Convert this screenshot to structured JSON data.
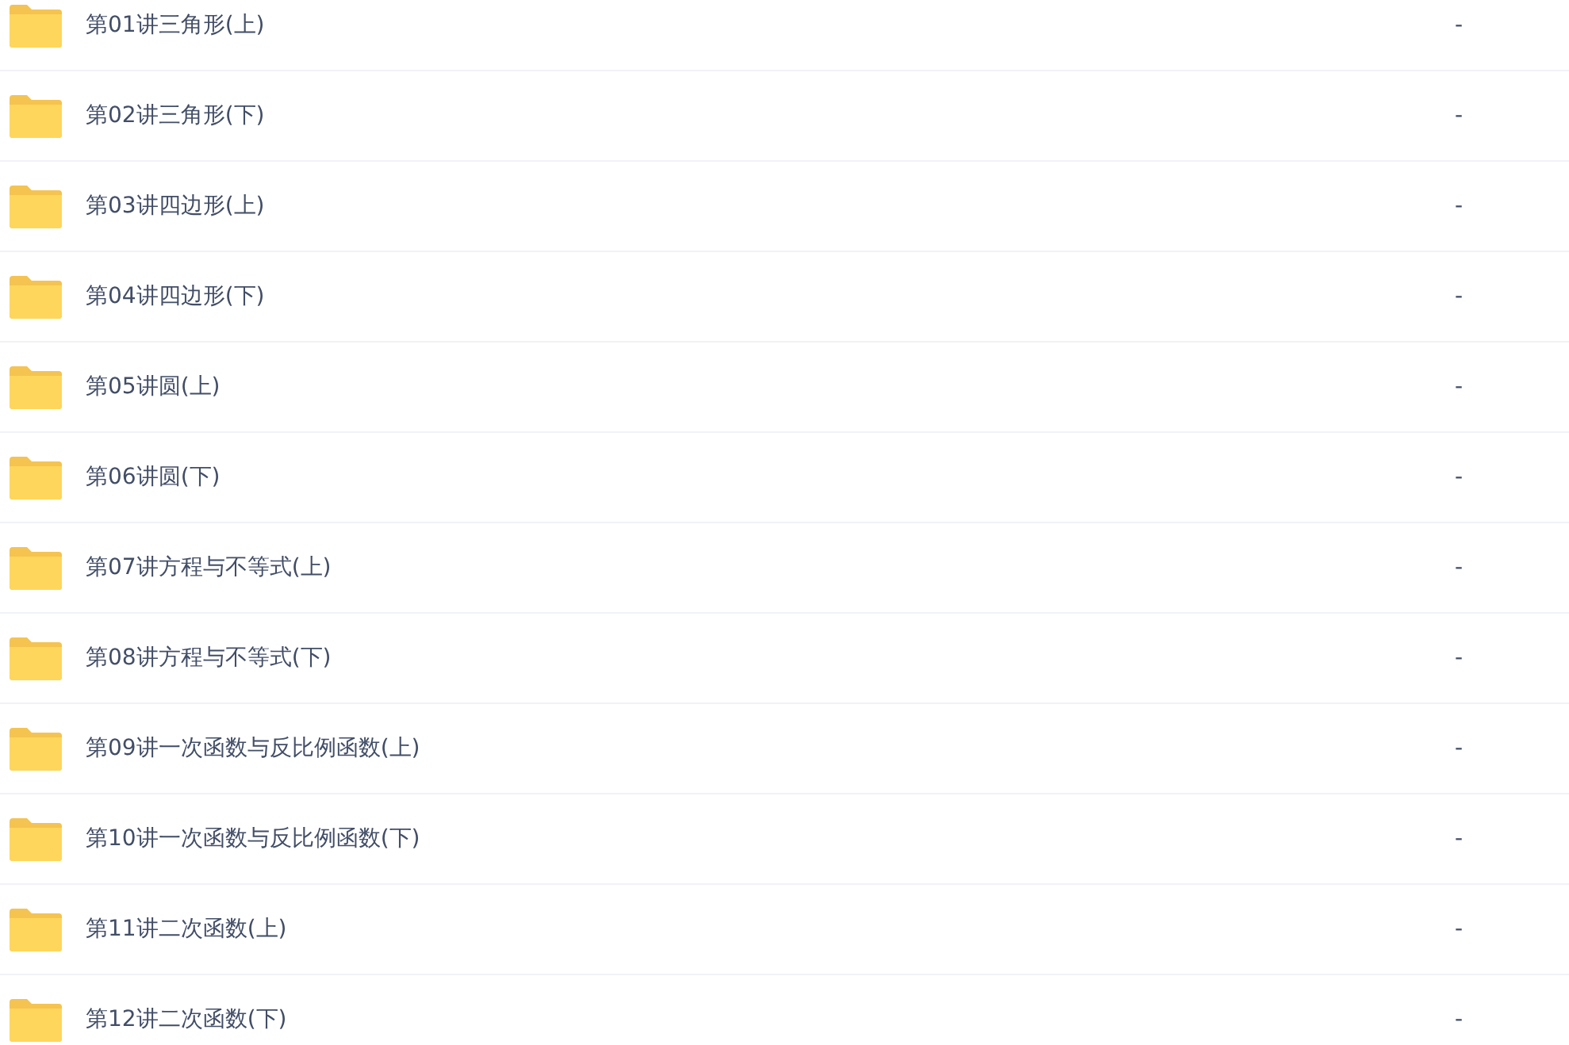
{
  "files": [
    {
      "name": "第01讲三角形(上)",
      "size": "-"
    },
    {
      "name": "第02讲三角形(下)",
      "size": "-"
    },
    {
      "name": "第03讲四边形(上)",
      "size": "-"
    },
    {
      "name": "第04讲四边形(下)",
      "size": "-"
    },
    {
      "name": "第05讲圆(上)",
      "size": "-"
    },
    {
      "name": "第06讲圆(下)",
      "size": "-"
    },
    {
      "name": "第07讲方程与不等式(上)",
      "size": "-"
    },
    {
      "name": "第08讲方程与不等式(下)",
      "size": "-"
    },
    {
      "name": "第09讲一次函数与反比例函数(上)",
      "size": "-"
    },
    {
      "name": "第10讲一次函数与反比例函数(下)",
      "size": "-"
    },
    {
      "name": "第11讲二次函数(上)",
      "size": "-"
    },
    {
      "name": "第12讲二次函数(下)",
      "size": "-"
    }
  ]
}
